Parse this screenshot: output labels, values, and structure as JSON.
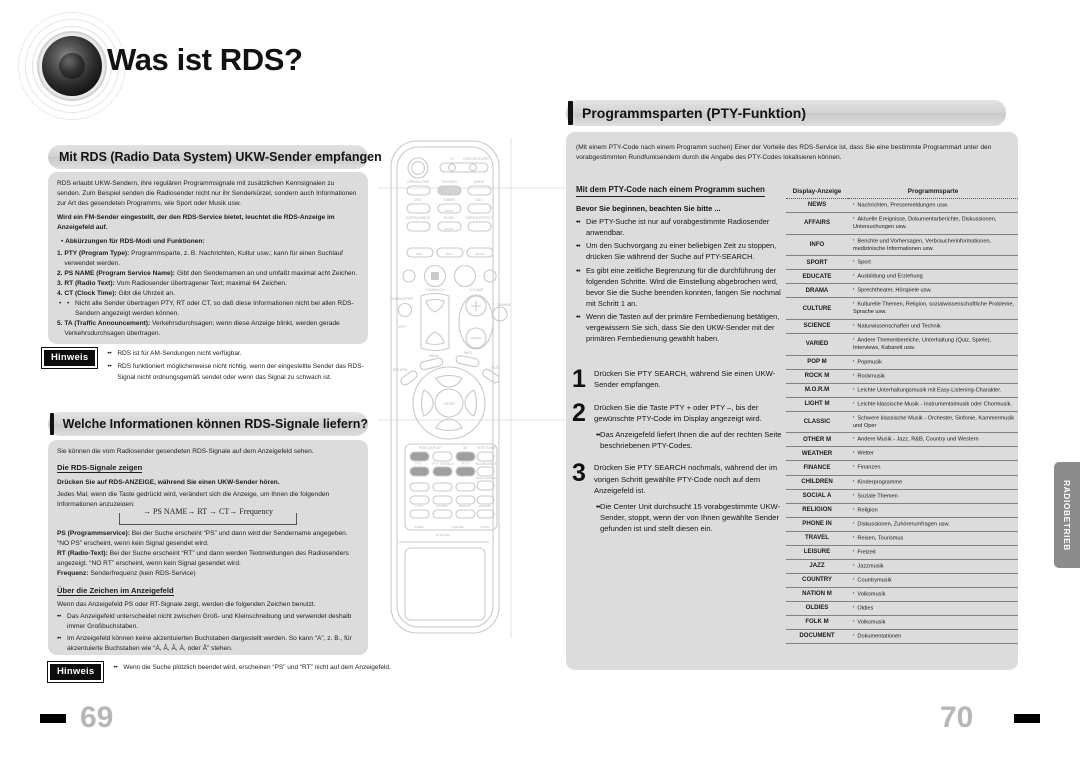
{
  "document": {
    "main_title": "Was ist RDS?",
    "side_tab": "RADIOBETRIEB",
    "page_left": "69",
    "page_right": "70"
  },
  "left_column": {
    "section1": {
      "heading": "Mit RDS (Radio Data System) UKW-Sender empfangen",
      "intro": "RDS erlaubt UKW-Sendern, ihre regulären Programmsignale mit zusätzlichen Kennsignalen zu senden. Zum Beispiel senden die Radiosender nicht nur ihr Senderkürzel, sondern auch Informationen zur Art des gesendeten Programms, wie Sport oder Musik usw.",
      "bold_note": "Wird ein FM-Sender eingestellt, der den RDS-Service bietet, leuchtet die RDS-Anzeige im Anzeigefeld auf.",
      "list_intro": "Abkürzungen für RDS-Modi und Funktionen:",
      "items": [
        {
          "term": "PTY (Program Type):",
          "text": " Programmsparte, z. B. Nachrichten, Kultur usw.; kann für einen Suchlauf verwendet werden."
        },
        {
          "term": "PS NAME (Program Service Name):",
          "text": " Gibt den Sendernamen an und umfaßt maximal acht Zeichen."
        },
        {
          "term": "RT (Radio Text):",
          "text": " Vom Radiosender übertragener Text; maximal 64 Zeichen."
        },
        {
          "term": "CT (Clock Time):",
          "text": " Gibt die Uhrzeit an."
        },
        {
          "term": "TA (Traffic Announcement):",
          "text": " Verkehrsdurchsagen; wenn diese Anzeige blinkt, werden gerade Verkehrsdurchsagen übertragen."
        }
      ],
      "ct_subnote": "Nicht alle Sender übertragen PTY, RT oder CT, so daß diese Informationen nicht bei allen RDS-Sendern angezeigt werden können.",
      "hinweis_label": "Hinweis",
      "hinweis_items": [
        "RDS ist für AM-Sendungen nicht  verfügbar.",
        "RDS funktioniert möglicherweise nicht richtig, wenn der eingestellte Sender das RDS-Signal nicht ordnungsgemäß sendet oder wenn das Signal zu schwach ist."
      ]
    },
    "section2": {
      "heading": "Welche Informationen können RDS-Signale liefern?",
      "intro": "Sie können die vom Radiosender gesendeten RDS-Signale auf dem Anzeigefeld sehen.",
      "sub1": "Die RDS-Signale zeigen",
      "bold_line": "Drücken Sie auf RDS-ANZEIGE, während Sie einen UKW-Sender hören.",
      "para": "Jedes Mal, wenn die Taste gedrückt wird, verändert sich die Anzeige, um Ihnen die folgenden Informationen anzuzeigen:",
      "flow": "→ PS NAME→ RT → CT→ Frequency",
      "defs": [
        {
          "term": "PS (Programmservice):",
          "text": " Bei der Suche erscheint “PS” und dann wird der Sendername angegeben. “NO PS” erscheint, wenn kein Signal gesendet wird."
        },
        {
          "term": "RT (Radio-Text):",
          "text": " Bei der Suche erscheint “RT” und dann werden Textmeldungen des Radiosenders angezeigt. “NO RT” erscheint, wenn kein Signal gesendet wird."
        },
        {
          "term": "Frequenz:",
          "text": " Senderfrequenz (kein RDS-Service)"
        }
      ],
      "sub2": "Über die Zeichen im Anzeigefeld",
      "para2": "Wenn das Anzeigefeld PS oder RT-Signale zeigt, werden die folgenden Zeichen benutzt.",
      "bullets": [
        "Das Anzeigefeld unterscheidet nicht zwischen Groß- und Kleinschreibung und verwendet deshalb immer Großbuchstaben.",
        "Im Anzeigefeld können keine akzentuierten Buchstaben dargestellt werden. So kann “A”, z. B., für akzentuierte Buchstaben wie “Á, Â, Ã, Ä,  oder Å” stehen."
      ],
      "hinweis_label": "Hinweis",
      "hinweis_items": [
        "Wenn die Suche plötzlich beendet wird, erscheinen “PS” und “RT” nicht auf dem Anzeigefeld."
      ]
    }
  },
  "right_column": {
    "heading": "Programmsparten (PTY-Funktion)",
    "intro": "(Mit einem PTY-Code nach einem Programm suchen) Einer der Vorteile des RDS-Service ist, dass Sie eine bestimmte Programmart unter den vorabgestimmten Rundfunksendern durch die Angabe des PTY-Codes lokalisieren können.",
    "sub_heading": "Mit dem PTY-Code nach einem Programm suchen",
    "before_title": "Bevor Sie beginnen, beachten Sie bitte ...",
    "before_items": [
      "Die PTY-Suche ist nur auf vorabgestimmte Radiosender anwendbar.",
      "Um den Suchvorgang zu einer beliebigen Zeit zu stoppen, drücken Sie während der Suche auf PTY-SEARCH.",
      "Es gibt eine zeitliche Begrenzung für die durchführung der folgenden Schritte. Wird die Einstellung abgebrochen wird, bevor Sie die Suche beenden konnten, fangen Sie nochmal mit Schritt 1 an.",
      "Wenn die Tasten auf der primäre Fernbedienung betätigen, vergewissern Sie sich, dass Sie den UKW-Sender mit der primären Fernbedienung gewählt haben."
    ],
    "steps": [
      {
        "num": "1",
        "text": "Drücken Sie PTY SEARCH, während Sie einen UKW-Sender empfangen.",
        "sub": ""
      },
      {
        "num": "2",
        "text": "Drücken Sie die Taste PTY + oder PTY –, bis der gewünschte PTY-Code im Display angezeigt wird.",
        "sub": "Das Anzeigefeld liefert Ihnen die auf der rechten Seite beschriebenen PTY-Codes."
      },
      {
        "num": "3",
        "text": "Drücken Sie PTY SEARCH nochmals, während der im vorigen Schritt gewählte PTY-Code noch auf dem Anzeigefeld ist.",
        "sub": "Die Center Unit durchsucht 15 vorabgestimmte UKW-Sender, stoppt, wenn der von Ihnen gewählte Sender gefunden ist und stellt diesen ein."
      }
    ],
    "pty_table": {
      "col1": "Display-Anzeige",
      "col2": "Programmsparte",
      "rows": [
        {
          "code": "NEWS",
          "desc": "Nachrichten, Pressemeldungen usw."
        },
        {
          "code": "AFFAIRS",
          "desc": "Aktuelle Ereignisse, Dokumentarberichte, Diskussionen, Untersuchungen usw."
        },
        {
          "code": "INFO",
          "desc": "Berichte und Vorhersagen, Verbraucherinformationen, medizinische Informationen usw."
        },
        {
          "code": "SPORT",
          "desc": "Sport"
        },
        {
          "code": "EDUCATE",
          "desc": "Ausbildung und Erziehung"
        },
        {
          "code": "DRAMA",
          "desc": "Sprechtheater, Hörspiele usw."
        },
        {
          "code": "CULTURE",
          "desc": "Kulturelle Themen, Religion, sozialwissenschaftliche Probleme, Sprache usw."
        },
        {
          "code": "SCIENCE",
          "desc": "Naturwissenschaften und Technik"
        },
        {
          "code": "VARIED",
          "desc": "Andere Themenbereiche, Unterhaltung (Quiz, Spiele), Interviews, Kabarett usw."
        },
        {
          "code": "POP M",
          "desc": "Popmusik"
        },
        {
          "code": "ROCK M",
          "desc": "Rockmusik"
        },
        {
          "code": "M.O.R.M",
          "desc": "Leichte Unterhaltungsmusik mit Easy-Listening-Charakter."
        },
        {
          "code": "LIGHT M",
          "desc": "Leichte klassische Musik -  Instrumentalmusik oder Chormusik."
        },
        {
          "code": "CLASSIC",
          "desc": "Schwere klassische Musik - Orchester, Sinfonie, Kammermusik und Oper"
        },
        {
          "code": "OTHER M",
          "desc": "Andere Musik - Jazz, R&B, Country und Western"
        },
        {
          "code": "WEATHER",
          "desc": "Wetter"
        },
        {
          "code": "FINANCE",
          "desc": "Finanzen"
        },
        {
          "code": "CHILDREN",
          "desc": "Kinderprogramme"
        },
        {
          "code": "SOCIAL A",
          "desc": "Soziale Themen"
        },
        {
          "code": "RELIGION",
          "desc": "Religion"
        },
        {
          "code": "PHONE IN",
          "desc": "Diskussionen, Zuhörerumfragen usw."
        },
        {
          "code": "TRAVEL",
          "desc": "Reisen, Tourismus"
        },
        {
          "code": "LEISURE",
          "desc": "Freizeit"
        },
        {
          "code": "JAZZ",
          "desc": "Jazzmusik"
        },
        {
          "code": "COUNTRY",
          "desc": "Countrymusik"
        },
        {
          "code": "NATION M",
          "desc": "Volksmusik"
        },
        {
          "code": "OLDIES",
          "desc": "Oldies"
        },
        {
          "code": "FOLK M",
          "desc": "Volksmusik"
        },
        {
          "code": "DOCUMENT",
          "desc": "Dokumentationen"
        }
      ]
    }
  },
  "remote": {
    "labels": {
      "tv": "TV",
      "dvd_receiver": "DVD RECEIVER",
      "open_close": "OPEN/CLOSE",
      "tv_video": "TV/VIDEO",
      "mode": "MODE",
      "dvd": "DVD",
      "tuner": "TUNER",
      "band": "BAND",
      "aux": "AUX",
      "dsp_mode": "DSP/EQ MODE",
      "slow": "SLOW",
      "mo_st": "MO/ST",
      "dsp_effect": "DSP/EQ EFFECT",
      "dim": "DIM -",
      "dim2": "DIM +",
      "mute": "MUTE",
      "tuning_ch": "TUNING/CH",
      "volume": "VOLUME",
      "subwoofer": "SUBWOOFER",
      "vfp": "V-FP",
      "remain": "REMAIN",
      "menu": "MENU",
      "info": "INFO",
      "return": "RETURN",
      "exit": "EXIT",
      "enter": "ENTER",
      "rds_display": "RDS DISPLAY",
      "ta": "TA",
      "test_tone": "TEST TONE",
      "pty_minus": "PTY-",
      "pty_search": "PTY SEARCH",
      "pty_plus": "PTY+",
      "sound_edit": "SOUND/EDIT",
      "disc_change": "DISC CHANGE",
      "sleep": "SLEEP",
      "cancel": "CANCEL",
      "zoom": "ZOOM",
      "logo": "LOGO",
      "p_view": "P./VIEW",
      "repeat": "REPEAT",
      "remain2": "REMAIN",
      "ntsc_pal": "NTSC/PAL"
    }
  }
}
